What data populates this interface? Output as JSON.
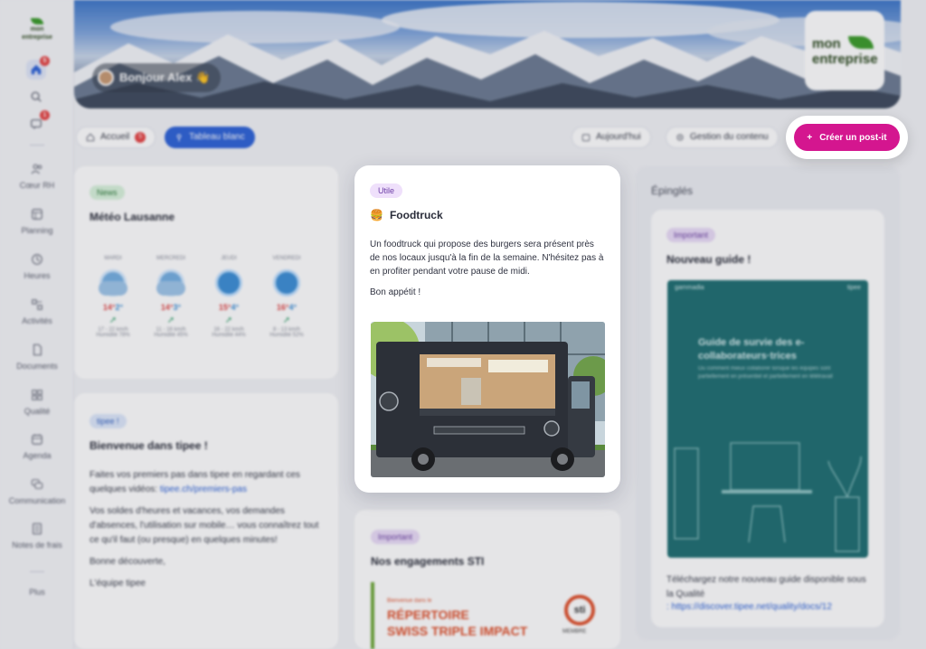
{
  "sidebar": {
    "logo": "mon entreprise",
    "badges": {
      "home": "5",
      "messages": "1"
    },
    "items": [
      {
        "label": "Cœur RH",
        "icon": "users-icon"
      },
      {
        "label": "Planning",
        "icon": "calendar-grid-icon"
      },
      {
        "label": "Heures",
        "icon": "clock-icon"
      },
      {
        "label": "Activités",
        "icon": "activities-icon"
      },
      {
        "label": "Documents",
        "icon": "document-icon"
      },
      {
        "label": "Qualité",
        "icon": "quality-icon"
      },
      {
        "label": "Agenda",
        "icon": "agenda-icon"
      },
      {
        "label": "Communication",
        "icon": "chat-icon"
      },
      {
        "label": "Notes de frais",
        "icon": "receipt-icon"
      },
      {
        "label": "Plus",
        "icon": "more-icon"
      }
    ]
  },
  "header": {
    "greeting": "Bonjour Alex 👋",
    "brand": "mon entreprise"
  },
  "toolbar": {
    "home_label": "Accueil",
    "home_badge": "5",
    "whiteboard_label": "Tableau blanc",
    "today_label": "Aujourd'hui",
    "content_label": "Gestion du contenu",
    "create_label": "Créer un post-it"
  },
  "weather_card": {
    "tag": "News",
    "title": "Météo Lausanne",
    "days": [
      {
        "day": "MARDI",
        "icon": "cloud-sun-icon",
        "max": "14°",
        "min": "2°",
        "wind": "17 - 22 km/h",
        "humidity": "Humidité 78%"
      },
      {
        "day": "MERCREDI",
        "icon": "cloud-sun-icon",
        "max": "14°",
        "min": "3°",
        "wind": "11 - 16 km/h",
        "humidity": "Humidité 45%"
      },
      {
        "day": "JEUDI",
        "icon": "sun-icon",
        "max": "15°",
        "min": "4°",
        "wind": "16 - 22 km/h",
        "humidity": "Humidité 44%"
      },
      {
        "day": "VENDREDI",
        "icon": "sun-icon",
        "max": "16°",
        "min": "4°",
        "wind": "8 - 13 km/h",
        "humidity": "Humidité 52%"
      }
    ]
  },
  "welcome_card": {
    "tag": "tipee !",
    "title": "Bienvenue dans tipee !",
    "p1_before": "Faites vos premiers pas dans tipee en regardant ces quelques vidéos: ",
    "p1_link": "tipee.ch/premiers-pas",
    "p2": "Vos soldes d'heures et vacances, vos demandes d'absences, l'utilisation sur mobile… vous connaîtrez tout ce qu'il faut (ou presque) en quelques minutes!",
    "p3": "Bonne découverte,",
    "p4": "L'équipe tipee"
  },
  "foodtruck_card": {
    "tag": "Utile",
    "emoji": "🍔",
    "title": "Foodtruck",
    "text": "Un foodtruck qui propose des burgers sera présent près de nos locaux jusqu'à la fin de la semaine. N'hésitez pas à en profiter pendant votre pause de midi.",
    "closing": "Bon appétit !"
  },
  "sti_card": {
    "tag": "Important",
    "title": "Nos engagements STI",
    "image_small": "Bienvenue dans le",
    "image_line1": "RÉPERTOIRE",
    "image_line2": "SWISS TRIPLE IMPACT",
    "badge": "sti",
    "badge_caption": "MEMBRE"
  },
  "pinned": {
    "title": "Épinglés",
    "card_tag": "Important",
    "card_title": "Nouveau guide !",
    "guide_brand_left": "gammadia",
    "guide_brand_right": "tipee",
    "guide_heading": "Guide de survie des e-collaborateurs·trices",
    "guide_sub": "Ou comment mieux collaborer lorsque les équipes sont partiellement en présentiel et partiellement en télétravail",
    "text": "Téléchargez notre nouveau guide disponible sous la Qualité",
    "link": ": https://discover.tipee.net/quality/docs/12"
  }
}
